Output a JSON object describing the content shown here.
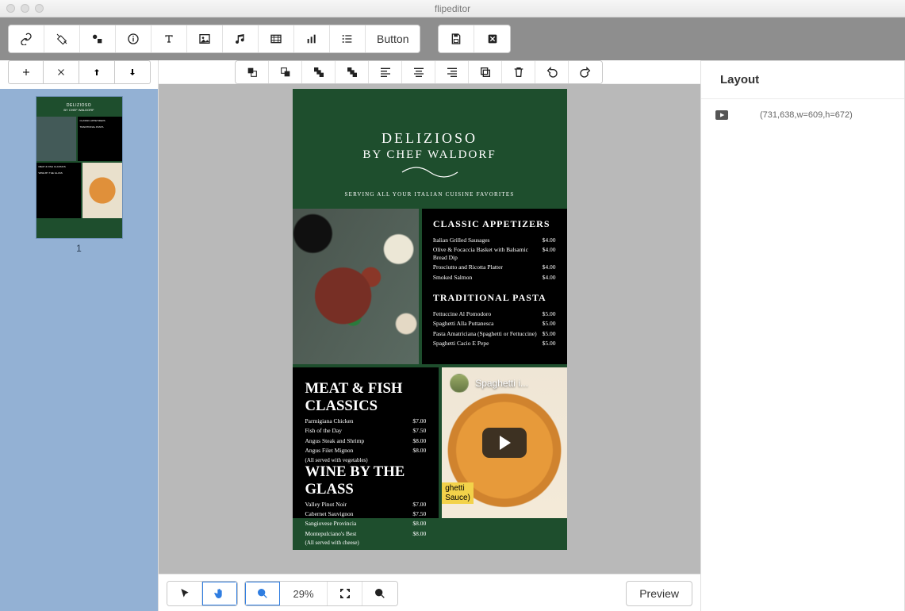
{
  "window": {
    "title": "flipeditor"
  },
  "toolbar": {
    "button_label": "Button"
  },
  "thumbs": {
    "page_number": "1"
  },
  "menu": {
    "title": "DELIZIOSO",
    "byline": "BY CHEF WALDORF",
    "serving": "SERVING ALL YOUR ITALIAN CUISINE FAVORITES",
    "sections": {
      "appetizers": {
        "heading": "CLASSIC APPETIZERS",
        "items": [
          {
            "name": "Italian Grilled Sausages",
            "price": "$4.00"
          },
          {
            "name": "Olive & Focaccia Basket with Balsamic Bread Dip",
            "price": "$4.00"
          },
          {
            "name": "Prosciutto and Ricotta Platter",
            "price": "$4.00"
          },
          {
            "name": "Smoked Salmon",
            "price": "$4.00"
          }
        ]
      },
      "pasta": {
        "heading": "TRADITIONAL PASTA",
        "items": [
          {
            "name": "Fettuccine Al Pomodoro",
            "price": "$5.00"
          },
          {
            "name": "Spaghetti Alla Puttanesca",
            "price": "$5.00"
          },
          {
            "name": "Pasta Amatriciana (Spaghetti or Fettuccine)",
            "price": "$5.00"
          },
          {
            "name": "Spaghetti Cacio E Pepe",
            "price": "$5.00"
          }
        ]
      },
      "meatfish": {
        "heading": "MEAT & FISH CLASSICS",
        "items": [
          {
            "name": "Parmigiana Chicken",
            "price": "$7.00"
          },
          {
            "name": "Fish of the Day",
            "price": "$7.50"
          },
          {
            "name": "Angus Steak and Shrimp",
            "price": "$8.00"
          },
          {
            "name": "Angus Filet Mignon",
            "price": "$8.00"
          }
        ],
        "note": "(All served with vegetables)"
      },
      "wine": {
        "heading": "WINE BY THE GLASS",
        "items": [
          {
            "name": "Valley Pinot Noir",
            "price": "$7.00"
          },
          {
            "name": "Cabernet Sauvignon",
            "price": "$7.50"
          },
          {
            "name": "Sangiovese Provincia",
            "price": "$8.00"
          },
          {
            "name": "Montepulciano's Best",
            "price": "$8.00"
          }
        ],
        "note": "(All served with cheese)"
      }
    },
    "video": {
      "title": "Spaghetti i...",
      "caption_line1": "ghetti",
      "caption_line2": "Sauce)"
    }
  },
  "footer": {
    "zoom": "29%",
    "preview": "Preview"
  },
  "layout_panel": {
    "heading": "Layout",
    "item_coords": "(731,638,w=609,h=672)"
  }
}
